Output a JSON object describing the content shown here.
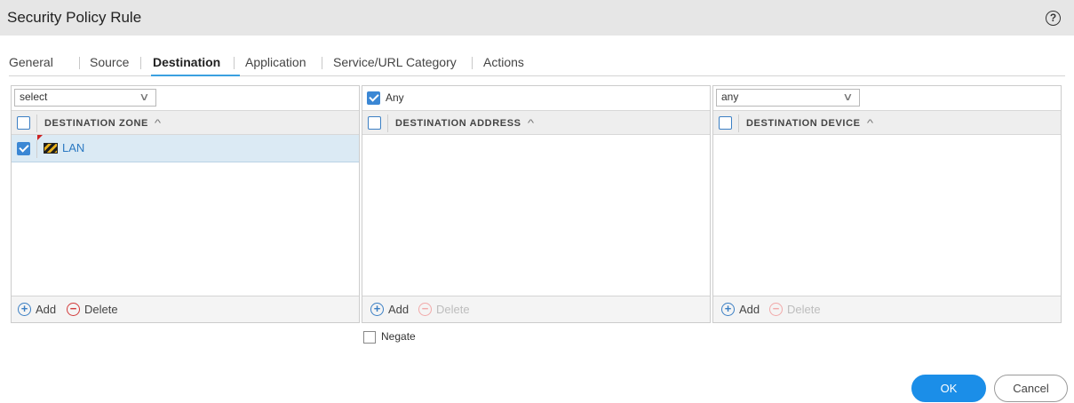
{
  "window": {
    "title": "Security Policy Rule",
    "help_icon": "help-circle-icon"
  },
  "tabs": [
    {
      "label": "General",
      "active": false
    },
    {
      "label": "Source",
      "active": false
    },
    {
      "label": "Destination",
      "active": true
    },
    {
      "label": "Application",
      "active": false
    },
    {
      "label": "Service/URL Category",
      "active": false
    },
    {
      "label": "Actions",
      "active": false
    }
  ],
  "zone_panel": {
    "select_value": "select",
    "header": "DESTINATION ZONE",
    "rows": [
      {
        "label": "LAN",
        "checked": true,
        "icon": "zone-icon"
      }
    ],
    "add_label": "Add",
    "delete_label": "Delete"
  },
  "address_panel": {
    "any_label": "Any",
    "any_checked": true,
    "header": "DESTINATION ADDRESS",
    "add_label": "Add",
    "delete_label": "Delete"
  },
  "device_panel": {
    "select_value": "any",
    "header": "DESTINATION DEVICE",
    "add_label": "Add",
    "delete_label": "Delete"
  },
  "negate_label": "Negate",
  "buttons": {
    "ok": "OK",
    "cancel": "Cancel"
  },
  "colors": {
    "accent": "#1b8ee8",
    "link": "#2b79c2",
    "selected_row": "#dbeaf4",
    "delete": "#d23b3b"
  }
}
